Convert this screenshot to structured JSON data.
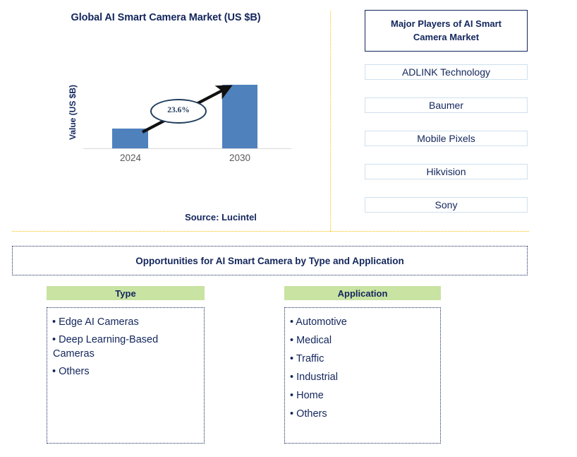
{
  "chart_data": {
    "type": "bar",
    "title": "Global AI Smart Camera Market (US $B)",
    "xlabel": "",
    "ylabel": "Value (US $B)",
    "categories": [
      "2024",
      "2030"
    ],
    "values": [
      28,
      90
    ],
    "value_units": "relative bar height (US $B, unlabeled axis)",
    "annotations": [
      {
        "label": "23.6%",
        "kind": "cagr-callout",
        "from": "2024",
        "to": "2030"
      }
    ],
    "grid": false,
    "legend": null,
    "bar_color": "#4F81BD",
    "axis_color": "#D9D9D9",
    "source": "Source: Lucintel"
  },
  "chart": {
    "title": "Global AI Smart Camera Market (US $B)",
    "y_axis_label": "Value (US $B)",
    "x_ticks": [
      "2024",
      "2030"
    ],
    "cagr_label": "23.6%",
    "source": "Source: Lucintel"
  },
  "players": {
    "header": "Major Players of AI Smart Camera Market",
    "items": [
      "ADLINK Technology",
      "Baumer",
      "Mobile Pixels",
      "Hikvision",
      "Sony"
    ]
  },
  "opportunities": {
    "title": "Opportunities for AI Smart Camera by Type and Application",
    "columns": [
      {
        "header": "Type",
        "items": [
          "• Edge AI Cameras",
          "• Deep Learning-Based Cameras",
          "• Others"
        ]
      },
      {
        "header": "Application",
        "items": [
          "• Automotive",
          "• Medical",
          "• Traffic",
          "• Industrial",
          "• Home",
          "• Others"
        ]
      }
    ]
  },
  "colors": {
    "navy_text": "#13265C",
    "bar_blue": "#4F81BD",
    "green_header": "#C9E3A2",
    "orange_divider": "#FFBF00",
    "light_blue_border": "#CFE0EE"
  }
}
